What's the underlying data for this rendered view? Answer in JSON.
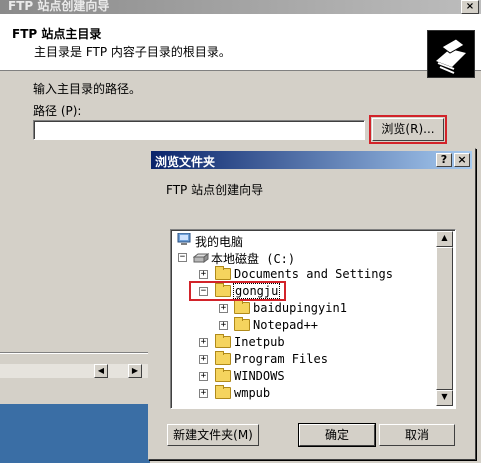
{
  "wizard": {
    "title": "FTP 站点创建向导",
    "header_title": "FTP 站点主目录",
    "header_subtitle": "主目录是 FTP 内容子目录的根目录。",
    "path_prompt": "输入主目录的路径。",
    "path_label": "路径 (P):",
    "path_value": "",
    "browse_label": "浏览(R)...",
    "close_glyph": "×"
  },
  "dialog": {
    "title": "浏览文件夹",
    "help_glyph": "?",
    "close_glyph": "×",
    "description": "FTP 站点创建向导",
    "buttons": {
      "new_folder": "新建文件夹(M)",
      "ok": "确定",
      "cancel": "取消"
    }
  },
  "tree": {
    "items": [
      {
        "label": "我的电脑",
        "icon": "computer-icon"
      },
      {
        "label": "本地磁盘 (C:)",
        "icon": "drive-icon",
        "expander": "−"
      },
      {
        "label": "Documents and Settings",
        "icon": "folder-icon",
        "expander": "+"
      },
      {
        "label": "gongju",
        "icon": "folder-open-icon",
        "expander": "−",
        "selected": true
      },
      {
        "label": "baidupingyin1",
        "icon": "folder-icon",
        "expander": "+"
      },
      {
        "label": "Notepad++",
        "icon": "folder-icon",
        "expander": "+"
      },
      {
        "label": "Inetpub",
        "icon": "folder-icon",
        "expander": "+"
      },
      {
        "label": "Program Files",
        "icon": "folder-icon",
        "expander": "+"
      },
      {
        "label": "WINDOWS",
        "icon": "folder-icon",
        "expander": "+"
      },
      {
        "label": "wmpub",
        "icon": "folder-icon",
        "expander": "+"
      }
    ]
  },
  "colors": {
    "highlight_box": "#d2232a",
    "title_active": "#0a246a",
    "desktop": "#3a6ea5"
  }
}
